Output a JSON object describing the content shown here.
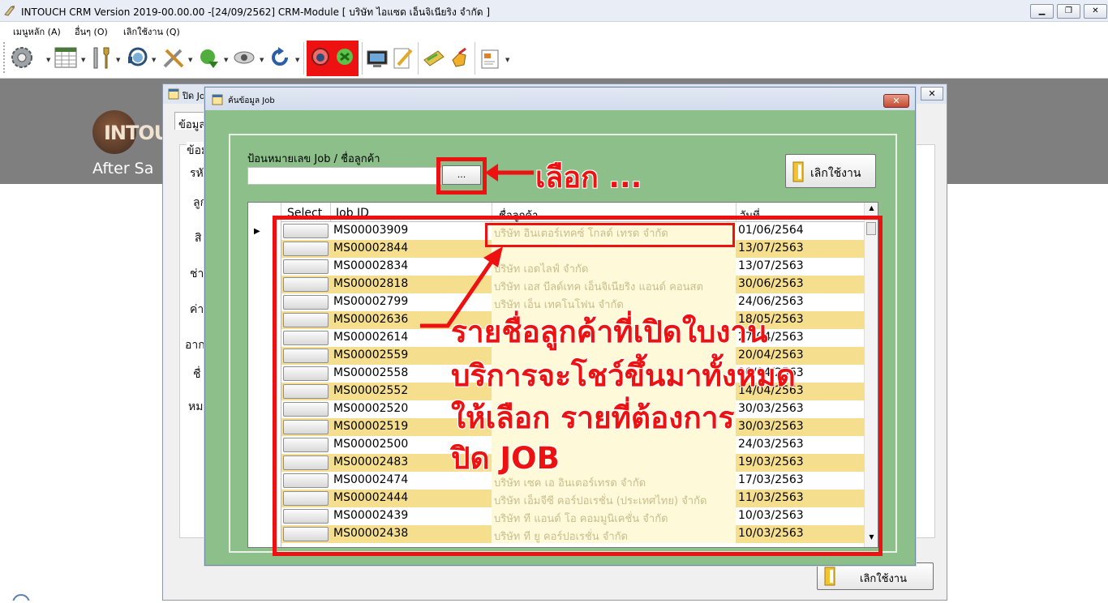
{
  "window": {
    "title": "INTOUCH CRM Version 2019-00.00.00 -[24/09/2562] CRM-Module  [ บริษัท ไอแซด เอ็นจิเนียริง จำกัด ]",
    "minimize": "▁",
    "restore": "❐",
    "close": "✕"
  },
  "menu": {
    "items": [
      "เมนูหลัก (A)",
      "อื่นๆ (O)",
      "เลิกใช้งาน (Q)"
    ]
  },
  "toolbar": {
    "icons": [
      "settings-gear",
      "table-grid",
      "tools-wrench",
      "headset-user",
      "repair-tools",
      "green-arrow-sync",
      "eye-lens",
      "refresh-arrow",
      "close-job-active",
      "monitor-screen",
      "edit-pencil",
      "wallet-payment",
      "hand-pointer",
      "report-slides"
    ]
  },
  "background": {
    "logo_text": "INTOU",
    "logo_sub": "After Sa"
  },
  "back_dialog": {
    "title": "ปิด Job",
    "close": "✕",
    "tab_label": "ข้อมูล",
    "group_label": "ข้อม",
    "labels": [
      "รหั",
      "ลูก",
      "สิ",
      "ช่า",
      "ค่า",
      "อาก",
      "ชื่",
      "หม"
    ],
    "cancel_label": "เลิกใช้งาน"
  },
  "dialog": {
    "title": "ค้นข้อมูล Job",
    "close": "✕",
    "search_label": "ป้อนหมายเลข Job / ชื่อลูกค้า",
    "search_value": "",
    "browse_label": "...",
    "cancel_label": "เลิกใช้งาน"
  },
  "grid": {
    "columns": [
      "Select",
      "Job ID",
      "ชื่อลูกค้า",
      "วันที่"
    ],
    "rows": [
      {
        "job_id": "MS00003909",
        "customer": "บริษัท อินเตอร์เทคซ์ โกลด์ เทรด จำกัด",
        "date": "01/06/2564"
      },
      {
        "job_id": "MS00002844",
        "customer": "",
        "date": "13/07/2563"
      },
      {
        "job_id": "MS00002834",
        "customer": "บริษัท เอดไลฟ์ จำกัด",
        "date": "13/07/2563"
      },
      {
        "job_id": "MS00002818",
        "customer": "บริษัท เอส บีลด์เทค เอ็นจิเนียริง แอนด์ คอนสต",
        "date": "30/06/2563"
      },
      {
        "job_id": "MS00002799",
        "customer": "บริษัท เอ็น เทคโนโฟน จำกัด",
        "date": "24/06/2563"
      },
      {
        "job_id": "MS00002636",
        "customer": "",
        "date": "18/05/2563"
      },
      {
        "job_id": "MS00002614",
        "customer": "",
        "date": "27/04/2563"
      },
      {
        "job_id": "MS00002559",
        "customer": "",
        "date": "20/04/2563"
      },
      {
        "job_id": "MS00002558",
        "customer": "",
        "date": "20/04/2563"
      },
      {
        "job_id": "MS00002552",
        "customer": "",
        "date": "14/04/2563"
      },
      {
        "job_id": "MS00002520",
        "customer": "",
        "date": "30/03/2563"
      },
      {
        "job_id": "MS00002519",
        "customer": "",
        "date": "30/03/2563"
      },
      {
        "job_id": "MS00002500",
        "customer": "",
        "date": "24/03/2563"
      },
      {
        "job_id": "MS00002483",
        "customer": "",
        "date": "19/03/2563"
      },
      {
        "job_id": "MS00002474",
        "customer": "บริษัท เซค เอ อินเตอร์เทรด จำกัด",
        "date": "17/03/2563"
      },
      {
        "job_id": "MS00002444",
        "customer": "บริษัท เอ็มจีซี คอร์ปอเรชั่น (ประเทศไทย) จำกัด",
        "date": "11/03/2563"
      },
      {
        "job_id": "MS00002439",
        "customer": "บริษัท ที แอนด์ โอ คอมมูนิเคชั่น จำกัด",
        "date": "10/03/2563"
      },
      {
        "job_id": "MS00002438",
        "customer": "บริษัท ที ยู คอร์ปอเรชั่น จำกัด",
        "date": "10/03/2563"
      }
    ],
    "row_colors": {
      "odd": "#ffffff",
      "even": "#f5df8f",
      "name_col": "#fdf9d9"
    }
  },
  "annotations": {
    "select_hint": "เลือก ...",
    "list_hint": [
      "รายชื่อลูกค้าที่เปิดใบงาน",
      "บริการจะโชว์ขึ้นมาทั้งหมด",
      "ให้เลือก รายที่ต้องการ",
      "ปิด JOB"
    ],
    "color": "#ee1111"
  }
}
